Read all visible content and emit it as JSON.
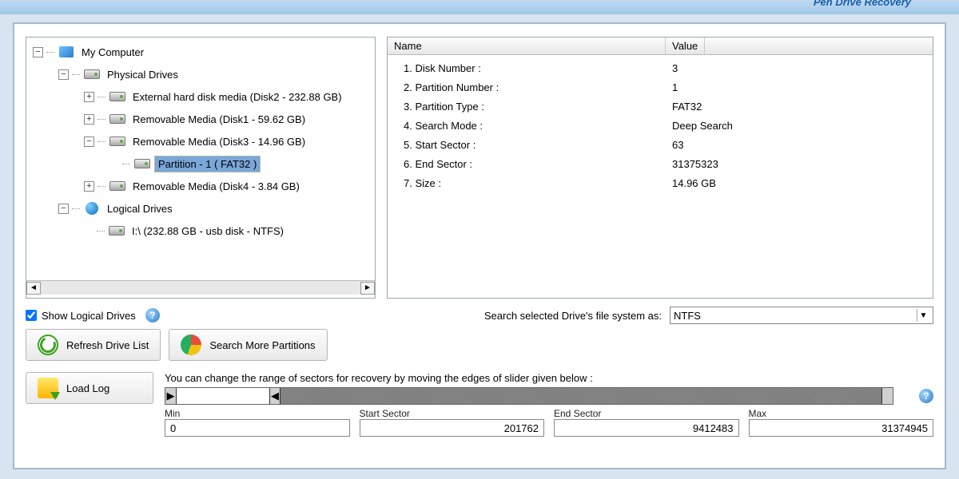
{
  "header": {
    "title": "Pen Drive Recovery"
  },
  "tree": {
    "root": "My Computer",
    "physical": "Physical Drives",
    "d0": "External hard disk media (Disk2 - 232.88 GB)",
    "d1": "Removable Media (Disk1 - 59.62 GB)",
    "d2": "Removable Media (Disk3 - 14.96 GB)",
    "d2p": "Partition - 1 ( FAT32 )",
    "d3": "Removable Media (Disk4 - 3.84 GB)",
    "logical": "Logical Drives",
    "l0": "I:\\ (232.88 GB - usb disk - NTFS)"
  },
  "props": {
    "col_name": "Name",
    "col_value": "Value",
    "rows": [
      {
        "n": "1. Disk Number :",
        "v": "3"
      },
      {
        "n": "2. Partition Number :",
        "v": "1"
      },
      {
        "n": "3. Partition Type :",
        "v": "FAT32"
      },
      {
        "n": "4. Search Mode :",
        "v": "Deep Search"
      },
      {
        "n": "5. Start Sector :",
        "v": "63"
      },
      {
        "n": "6. End Sector :",
        "v": "31375323"
      },
      {
        "n": "7. Size :",
        "v": "14.96 GB"
      }
    ]
  },
  "controls": {
    "show_logical": "Show Logical Drives",
    "refresh": "Refresh Drive List",
    "search_more": "Search More Partitions",
    "search_fs_label": "Search selected Drive's file system as:",
    "fs_value": "NTFS",
    "load_log": "Load Log"
  },
  "sectors": {
    "hint": "You can change the range of sectors for recovery by moving the edges of slider given below :",
    "min_label": "Min",
    "min": "0",
    "start_label": "Start Sector",
    "start": "201762",
    "end_label": "End Sector",
    "end": "9412483",
    "max_label": "Max",
    "max": "31374945"
  }
}
